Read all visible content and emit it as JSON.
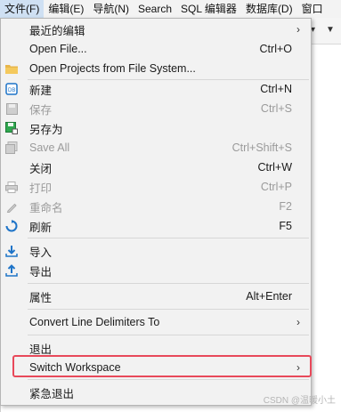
{
  "menubar": {
    "items": [
      "文件(F)",
      "编辑(E)",
      "导航(N)",
      "Search",
      "SQL 编辑器",
      "数据库(D)",
      "窗口"
    ]
  },
  "menu": {
    "items": [
      {
        "label": "最近的编辑",
        "shortcut": "",
        "submenu": true,
        "icon": "",
        "disabled": false
      },
      {
        "label": "Open File...",
        "shortcut": "Ctrl+O",
        "submenu": false,
        "icon": "",
        "disabled": false
      },
      {
        "label": "Open Projects from File System...",
        "shortcut": "",
        "submenu": false,
        "icon": "folder-icon",
        "disabled": false
      },
      {
        "label": "新建",
        "shortcut": "Ctrl+N",
        "submenu": false,
        "icon": "new-file-icon",
        "disabled": false
      },
      {
        "label": "保存",
        "shortcut": "Ctrl+S",
        "submenu": false,
        "icon": "save-icon",
        "disabled": true
      },
      {
        "label": "另存为",
        "shortcut": "",
        "submenu": false,
        "icon": "save-as-icon",
        "disabled": false
      },
      {
        "label": "Save All",
        "shortcut": "Ctrl+Shift+S",
        "submenu": false,
        "icon": "save-all-icon",
        "disabled": true
      },
      {
        "label": "关闭",
        "shortcut": "Ctrl+W",
        "submenu": false,
        "icon": "",
        "disabled": false
      },
      {
        "label": "打印",
        "shortcut": "Ctrl+P",
        "submenu": false,
        "icon": "print-icon",
        "disabled": true
      },
      {
        "label": "重命名",
        "shortcut": "F2",
        "submenu": false,
        "icon": "rename-icon",
        "disabled": true
      },
      {
        "label": "刷新",
        "shortcut": "F5",
        "submenu": false,
        "icon": "refresh-icon",
        "disabled": false
      },
      {
        "label": "导入",
        "shortcut": "",
        "submenu": false,
        "icon": "import-icon",
        "disabled": false
      },
      {
        "label": "导出",
        "shortcut": "",
        "submenu": false,
        "icon": "export-icon",
        "disabled": false
      },
      {
        "label": "属性",
        "shortcut": "Alt+Enter",
        "submenu": false,
        "icon": "",
        "disabled": false
      },
      {
        "label": "Convert Line Delimiters To",
        "shortcut": "",
        "submenu": true,
        "icon": "",
        "disabled": false
      },
      {
        "label": "退出",
        "shortcut": "",
        "submenu": false,
        "icon": "",
        "disabled": false
      },
      {
        "label": "Switch Workspace",
        "shortcut": "",
        "submenu": true,
        "icon": "",
        "disabled": false
      },
      {
        "label": "紧急退出",
        "shortcut": "",
        "submenu": false,
        "icon": "",
        "disabled": false
      }
    ]
  },
  "watermark": "CSDN @温暖小土",
  "colors": {
    "highlight": "#e8495a",
    "menu_bg": "#f2f2f2",
    "active_menubar": "#cfe0f3",
    "accent_blue": "#1e74c8"
  }
}
